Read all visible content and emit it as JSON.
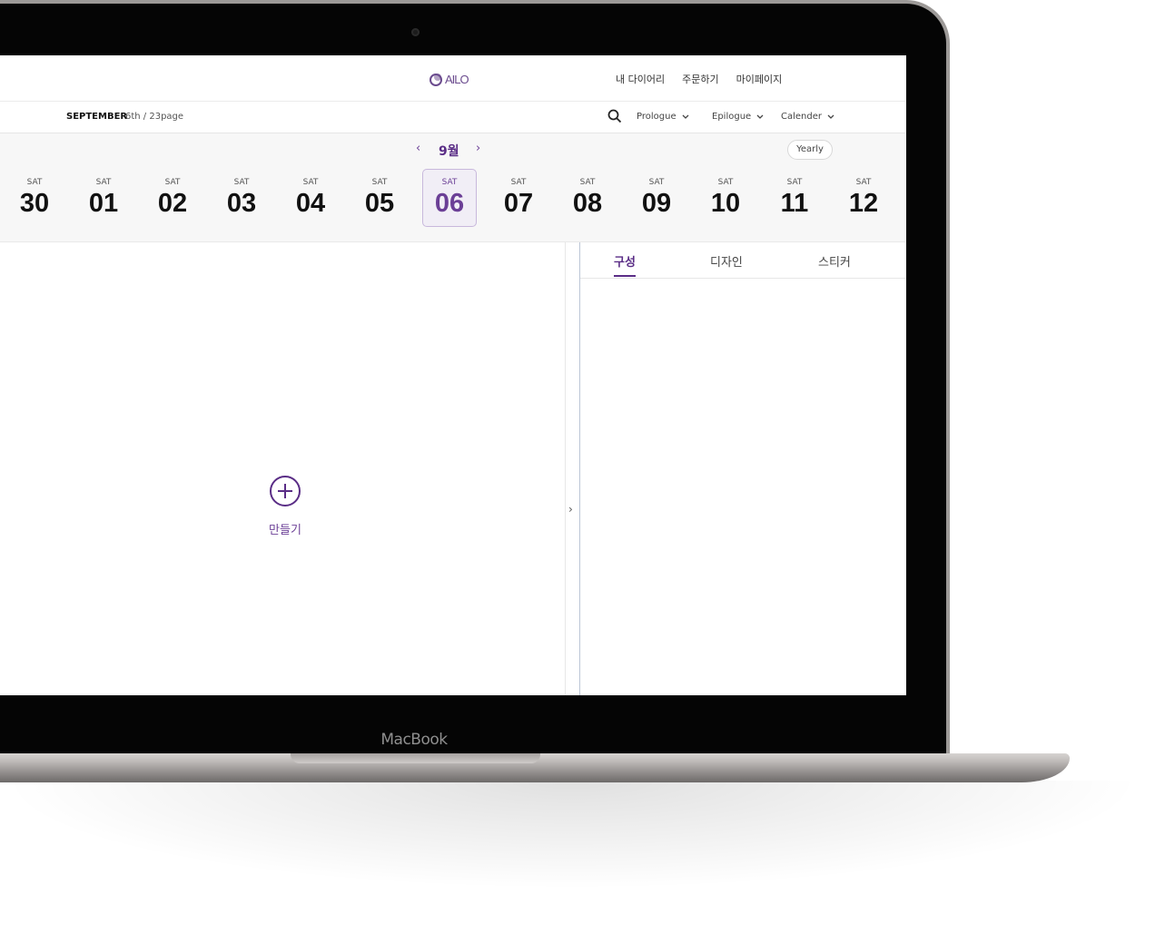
{
  "device": {
    "label": "MacBook"
  },
  "header": {
    "logo_text": "AILO",
    "nav": [
      "내 다이어리",
      "주문하기",
      "마이페이지"
    ]
  },
  "subbar": {
    "month": "SEPTEMBER",
    "page_info": "6th / 23page",
    "menus": [
      "Prologue",
      "Epilogue",
      "Calender"
    ]
  },
  "calendar": {
    "month_title": "9월",
    "prev": "‹",
    "next": "›",
    "yearly_label": "Yearly",
    "days": [
      {
        "dow": "SAT",
        "num": "30"
      },
      {
        "dow": "SAT",
        "num": "01"
      },
      {
        "dow": "SAT",
        "num": "02"
      },
      {
        "dow": "SAT",
        "num": "03"
      },
      {
        "dow": "SAT",
        "num": "04"
      },
      {
        "dow": "SAT",
        "num": "05"
      },
      {
        "dow": "SAT",
        "num": "06"
      },
      {
        "dow": "SAT",
        "num": "07"
      },
      {
        "dow": "SAT",
        "num": "08"
      },
      {
        "dow": "SAT",
        "num": "09"
      },
      {
        "dow": "SAT",
        "num": "10"
      },
      {
        "dow": "SAT",
        "num": "11"
      },
      {
        "dow": "SAT",
        "num": "12"
      }
    ],
    "selected_index": 6
  },
  "editor": {
    "create_label": "만들기"
  },
  "panel": {
    "tabs": [
      "구성",
      "디자인",
      "스티커"
    ],
    "active_tab": 0
  },
  "colors": {
    "accent": "#5a2d86",
    "selected_bg": "#f1eef6"
  }
}
